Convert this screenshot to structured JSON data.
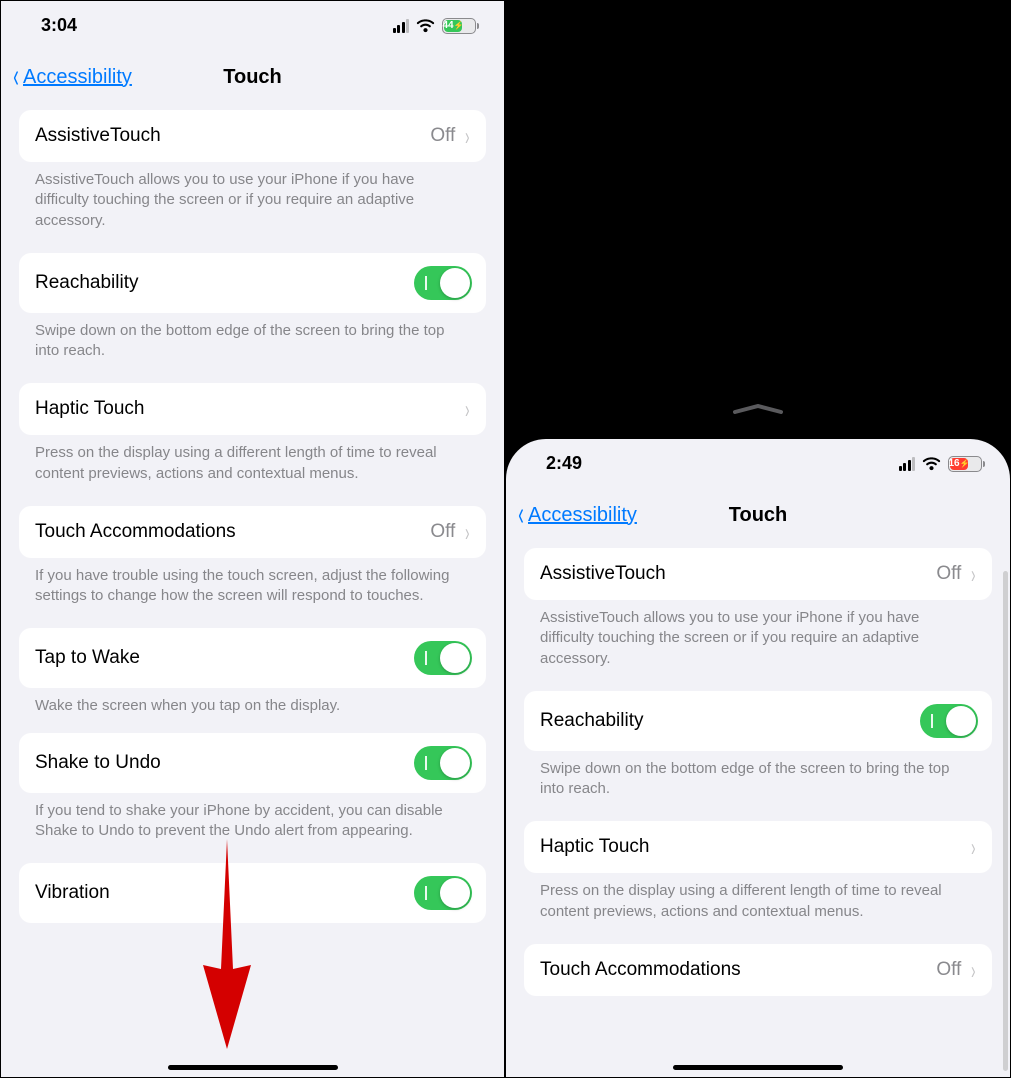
{
  "left": {
    "status": {
      "time": "3:04",
      "battery_text": "44"
    },
    "nav": {
      "back": "Accessibility",
      "title": "Touch"
    },
    "rows": {
      "assistive": {
        "label": "AssistiveTouch",
        "value": "Off",
        "desc": "AssistiveTouch allows you to use your iPhone if you have difficulty touching the screen or if you require an adaptive accessory."
      },
      "reachability": {
        "label": "Reachability",
        "desc": "Swipe down on the bottom edge of the screen to bring the top into reach."
      },
      "haptic": {
        "label": "Haptic Touch",
        "desc": "Press on the display using a different length of time to reveal content previews, actions and contextual menus."
      },
      "accom": {
        "label": "Touch Accommodations",
        "value": "Off",
        "desc": "If you have trouble using the touch screen, adjust the following settings to change how the screen will respond to touches."
      },
      "tap": {
        "label": "Tap to Wake",
        "desc": "Wake the screen when you tap on the display."
      },
      "shake": {
        "label": "Shake to Undo",
        "desc": "If you tend to shake your iPhone by accident, you can disable Shake to Undo to prevent the Undo alert from appearing."
      },
      "vibration": {
        "label": "Vibration"
      }
    }
  },
  "right": {
    "status": {
      "time": "2:49",
      "battery_text": "16"
    },
    "nav": {
      "back": "Accessibility",
      "title": "Touch"
    },
    "rows": {
      "assistive": {
        "label": "AssistiveTouch",
        "value": "Off",
        "desc": "AssistiveTouch allows you to use your iPhone if you have difficulty touching the screen or if you require an adaptive accessory."
      },
      "reachability": {
        "label": "Reachability",
        "desc": "Swipe down on the bottom edge of the screen to bring the top into reach."
      },
      "haptic": {
        "label": "Haptic Touch",
        "desc": "Press on the display using a different length of time to reveal content previews, actions and contextual menus."
      },
      "accom": {
        "label": "Touch Accommodations",
        "value": "Off"
      }
    }
  }
}
